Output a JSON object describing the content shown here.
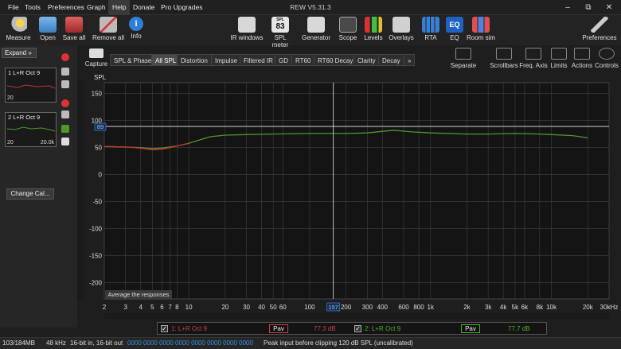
{
  "app": {
    "title": "REW V5.31.3"
  },
  "menu": [
    "File",
    "Tools",
    "Preferences",
    "Graph",
    "Help",
    "Donate",
    "Pro Upgrades"
  ],
  "menu_active": "Help",
  "window_controls": {
    "minimize": "–",
    "maximize": "⧉",
    "close": "✕"
  },
  "toolbar_left": [
    "Measure",
    "Open",
    "Save all",
    "Remove all",
    "Info"
  ],
  "toolbar_center": [
    "IR windows",
    "SPL meter",
    "Generator",
    "Scope",
    "Levels",
    "Overlays",
    "RTA",
    "EQ",
    "Room sim"
  ],
  "spl_meter_value": "83",
  "spl_meter_top": "SPL",
  "toolbar_right": [
    "Preferences"
  ],
  "left_panel": {
    "expand_label": "Expand »",
    "measurements": [
      {
        "title": "1 L+R Oct 9",
        "x_start": "20",
        "x_end": "",
        "color": "#c83232"
      },
      {
        "title": "2 L+R Oct 9",
        "x_start": "20",
        "x_end": "20.0k",
        "color": "#4c9a2a"
      }
    ],
    "change_cal_label": "Change Cal..."
  },
  "capture_label": "Capture",
  "tabs": [
    "SPL & Phase",
    "All SPL",
    "Distortion",
    "Impulse",
    "Filtered IR",
    "GD",
    "RT60",
    "RT60 Decay",
    "Clarity",
    "Decay",
    "»"
  ],
  "active_tab": "All SPL",
  "right_tools": [
    "Separate",
    "Scrollbars",
    "Freq. Axis",
    "Limits",
    "Actions",
    "Controls"
  ],
  "average_button_label": "Average the responses",
  "cursor": {
    "spl_readout": "89",
    "freq_readout": "157"
  },
  "chart_data": {
    "type": "line",
    "title": "",
    "xlabel": "",
    "ylabel": "SPL",
    "x_scale": "log",
    "xlim": [
      2,
      30000
    ],
    "ylim": [
      -230,
      170
    ],
    "grid": true,
    "y_ticks": [
      150,
      100,
      50,
      0,
      -50,
      -100,
      -150,
      -200
    ],
    "x_tick_labels": [
      "2",
      "3",
      "4",
      "5",
      "6",
      "7",
      "8",
      "10",
      "20",
      "30",
      "40",
      "50",
      "60",
      "100",
      "200",
      "300",
      "400",
      "600",
      "800",
      "1k",
      "2k",
      "3k",
      "4k",
      "5k",
      "6k",
      "8k",
      "10k",
      "20k",
      "30kHz"
    ],
    "x_tick_values": [
      2,
      3,
      4,
      5,
      6,
      7,
      8,
      10,
      20,
      30,
      40,
      50,
      60,
      100,
      200,
      300,
      400,
      600,
      800,
      1000,
      2000,
      3000,
      4000,
      5000,
      6000,
      8000,
      10000,
      20000,
      30000
    ],
    "cursor_line": {
      "x": 157,
      "y": 89
    },
    "series": [
      {
        "name": "1: L+R Oct 9",
        "color": "#c83232",
        "x": [
          2,
          3,
          4,
          5,
          6,
          7,
          8,
          10
        ],
        "y": [
          52,
          51,
          49,
          46,
          47,
          50,
          53,
          58
        ]
      },
      {
        "name": "2: L+R Oct 9",
        "color": "#4c9a2a",
        "x": [
          2,
          3,
          4,
          5,
          6,
          7,
          8,
          10,
          15,
          20,
          30,
          50,
          100,
          200,
          300,
          400,
          500,
          700,
          1000,
          2000,
          3000,
          5000,
          8000,
          10000,
          15000,
          20000
        ],
        "y": [
          52,
          51,
          50,
          48,
          49,
          51,
          53,
          58,
          70,
          73,
          74,
          75,
          76,
          76,
          77,
          80,
          82,
          79,
          77,
          75,
          75,
          76,
          75,
          74,
          72,
          68
        ]
      }
    ]
  },
  "legend": [
    {
      "label": "1: L+R Oct 9",
      "pav": "Pav",
      "value": "77.3 dB",
      "color": "#d04040",
      "checked": true
    },
    {
      "label": "2: L+R Oct 9",
      "pav": "Pav",
      "value": "77.7 dB",
      "color": "#4caf30",
      "checked": true
    }
  ],
  "status": {
    "memory": "103/184MB",
    "sample_rate": "48 kHz",
    "bits": "16-bit in, 16-bit out",
    "levels": "0000 0000  0000 0000  0000 0000  0000 0000",
    "message": "Peak input before clipping 120 dB SPL (uncalibrated)"
  }
}
